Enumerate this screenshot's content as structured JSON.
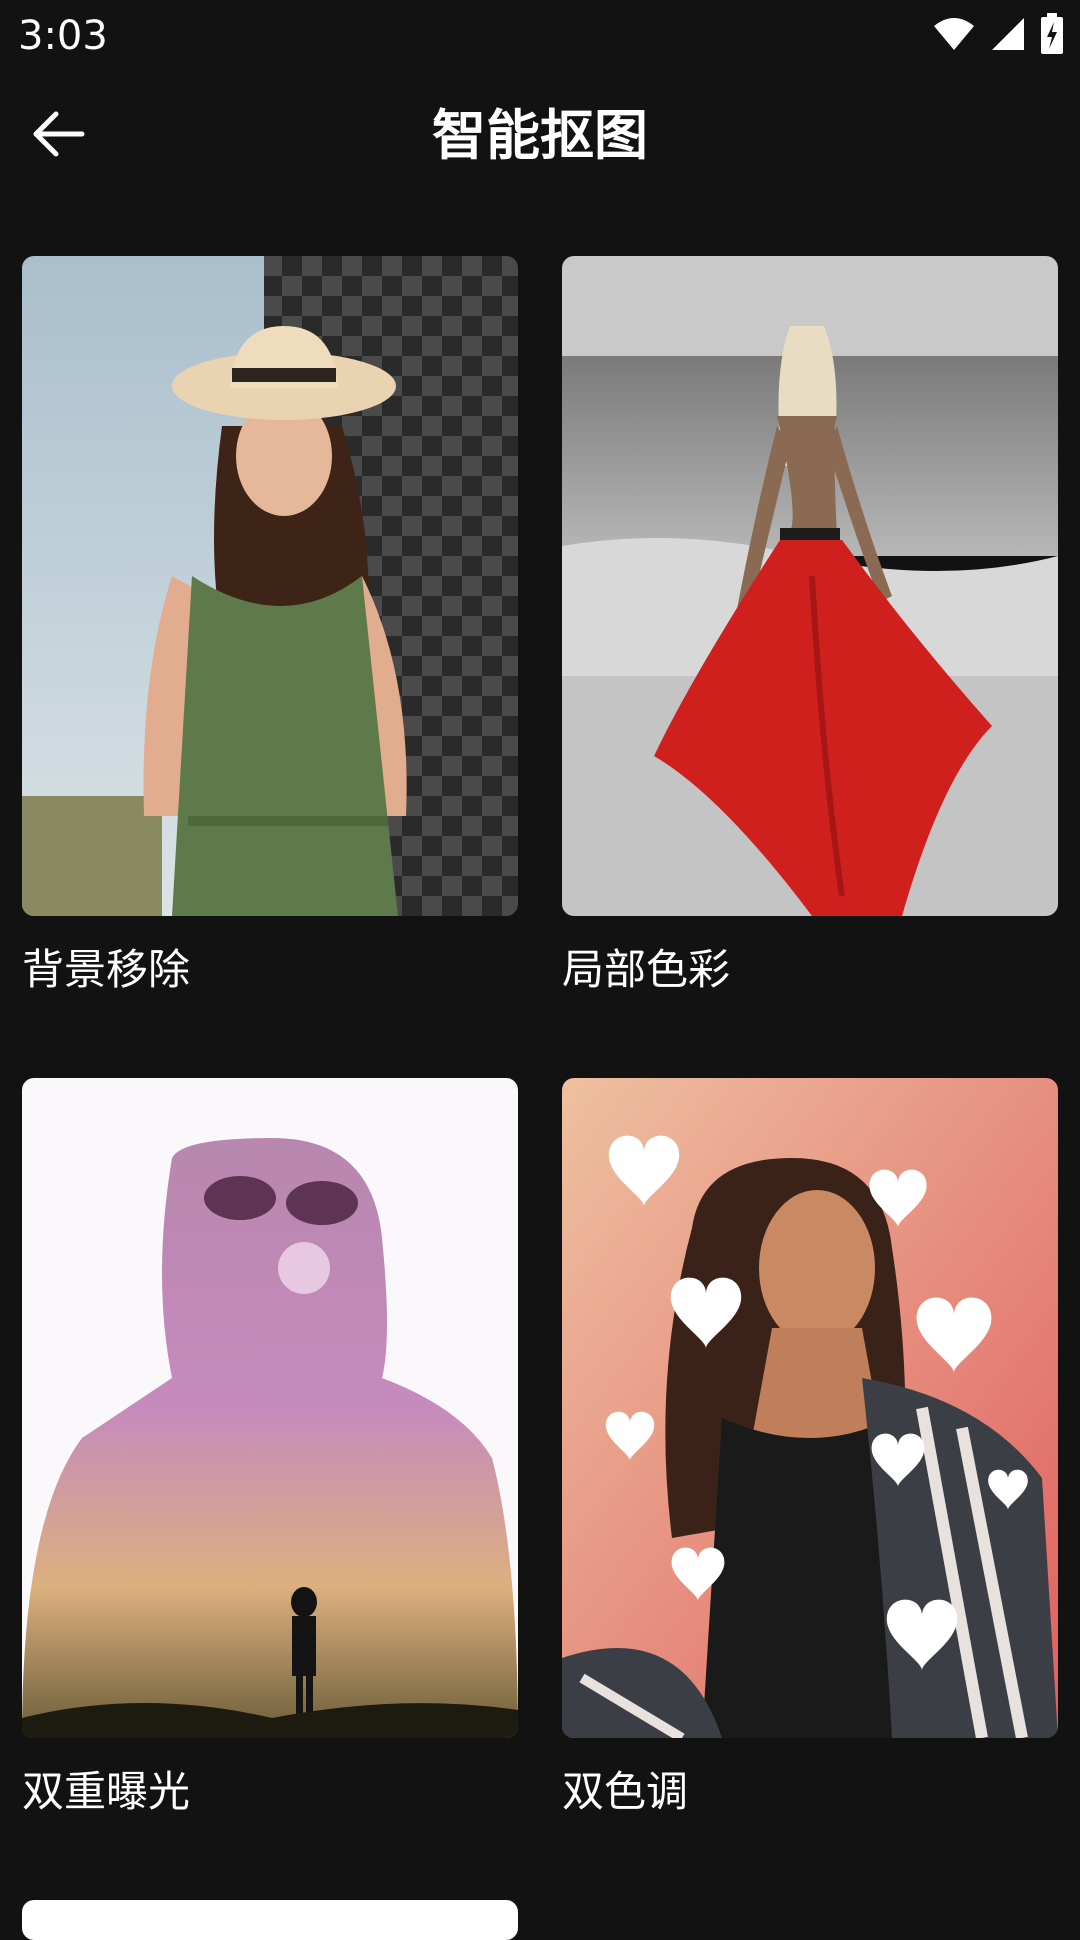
{
  "status_bar": {
    "time": "3:03",
    "icons": [
      "wifi-icon",
      "signal-icon",
      "battery-charging-icon"
    ]
  },
  "app_bar": {
    "back_icon": "arrow-left-icon",
    "title": "智能抠图"
  },
  "cards": [
    {
      "label": "背景移除",
      "image": "woman-in-hat-background-removed"
    },
    {
      "label": "局部色彩",
      "image": "woman-red-skirt-beach"
    },
    {
      "label": "双重曝光",
      "image": "double-exposure-silhouette"
    },
    {
      "label": "双色调",
      "image": "woman-hearts-duotone"
    }
  ],
  "colors": {
    "background": "#121212",
    "text": "#ffffff"
  }
}
